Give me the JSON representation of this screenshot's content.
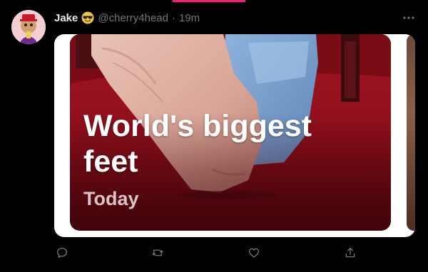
{
  "tweet": {
    "author_name": "Jake",
    "author_emoji": "sunglasses-face-emoji",
    "handle": "@cherry4head",
    "separator": "·",
    "time": "19m",
    "more_icon": "more-horizontal-icon",
    "more_label": "•••"
  },
  "media_card": {
    "title": "World's biggest feet",
    "subtitle": "Today"
  },
  "actions": [
    {
      "name": "reply",
      "icon": "comment-icon"
    },
    {
      "name": "retweet",
      "icon": "retweet-icon"
    },
    {
      "name": "like",
      "icon": "heart-icon"
    },
    {
      "name": "share",
      "icon": "share-icon"
    }
  ],
  "colors": {
    "background": "#000000",
    "text_primary": "#e7e9ea",
    "text_secondary": "#71767b",
    "accent_top_line": "#f91880",
    "emoji_yellow": "#f4c542"
  }
}
